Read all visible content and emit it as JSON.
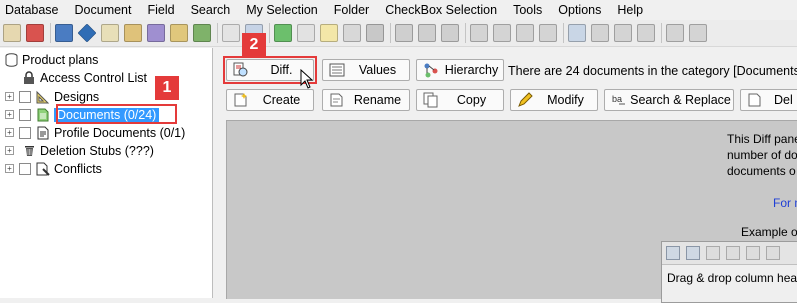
{
  "menu": [
    "Database",
    "Document",
    "Field",
    "Search",
    "My Selection",
    "Folder",
    "CheckBox Selection",
    "Tools",
    "Options",
    "Help"
  ],
  "toolbar_icons": [
    "db-icon",
    "refresh-icon",
    "filter-icon",
    "diamond-icon",
    "search-doc-icon",
    "edit-icon",
    "sign-icon",
    "find-icon",
    "export-icon",
    "calendar-icon",
    "grid-icon",
    "arrow-icon",
    "dxl-icon",
    "new-doc-icon",
    "copy-icon",
    "delete-icon",
    "check-icon",
    "cross-icon",
    "tools-icon",
    "doc2-icon",
    "trash-icon",
    "search2-icon",
    "chart-icon",
    "image-icon",
    "doc3-icon",
    "paint-icon",
    "link-icon",
    "info-icon",
    "doc4-icon"
  ],
  "tree": {
    "root": "Product plans",
    "items": [
      {
        "label": "Access Control List"
      },
      {
        "label": "Designs"
      },
      {
        "label": "Documents  (0/24)"
      },
      {
        "label": "Profile Documents  (0/1)"
      },
      {
        "label": "Deletion Stubs  (???)"
      },
      {
        "label": "Conflicts"
      }
    ]
  },
  "badges": {
    "one": "1",
    "two": "2"
  },
  "buttons": {
    "diff": "Diff.",
    "values": "Values",
    "hierarchy": "Hierarchy",
    "create": "Create",
    "rename": "Rename",
    "copy": "Copy",
    "modify": "Modify",
    "search_replace": "Search & Replace",
    "delete": "Del"
  },
  "status": "There are 24 documents in the category [Documents]",
  "panel": {
    "line1": "This Diff pane",
    "line2": "number of do",
    "line3": "documents o",
    "link": "For m",
    "example": "Example of a",
    "drag": "Drag & drop column hea"
  },
  "colors": {
    "highlight": "#e43a3a",
    "selection": "#3399ff",
    "link": "#1f3fd6"
  }
}
